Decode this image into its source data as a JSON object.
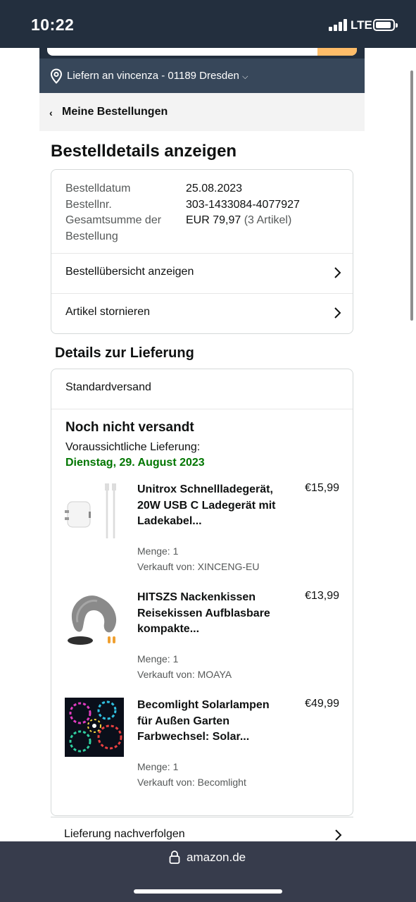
{
  "status_bar": {
    "time": "10:22",
    "network": "LTE"
  },
  "deliver_to": {
    "icon": "location-pin-icon",
    "text": "Liefern an vincenza - 01189 Dresden",
    "caret": "⌵"
  },
  "breadcrumb": {
    "label": "Meine Bestellungen"
  },
  "page_title": "Bestelldetails anzeigen",
  "order": {
    "date_label": "Bestelldatum",
    "date_value": "25.08.2023",
    "number_label": "Bestellnr.",
    "number_value": "303-1433084-4077927",
    "total_label": "Gesamtsumme der Bestellung",
    "total_value": "EUR 79,97",
    "total_count": "(3 Artikel)",
    "links": [
      {
        "label": "Bestellübersicht anzeigen"
      },
      {
        "label": "Artikel stornieren"
      }
    ]
  },
  "delivery": {
    "section_title": "Details zur Lieferung",
    "method": "Standardversand",
    "status": "Noch nicht versandt",
    "eta_label": "Voraussichtliche Lieferung:",
    "eta_date": "Dienstag, 29. August 2023",
    "status_color": "#007600",
    "items": [
      {
        "title": "Unitrox Schnellladegerät, 20W USB C Ladegerät mit Ladekabel...",
        "price": "€15,99",
        "qty": "Menge: 1",
        "seller": "Verkauft von: XINCENG-EU",
        "image": "usb-charger-image"
      },
      {
        "title": "HITSZS Nackenkissen Reisekissen Aufblasbare kompakte...",
        "price": "€13,99",
        "qty": "Menge: 1",
        "seller": "Verkauft von: MOAYA",
        "image": "neck-pillow-image"
      },
      {
        "title": "Becomlight Solarlampen für Außen Garten Farbwechsel: Solar...",
        "price": "€49,99",
        "qty": "Menge: 1",
        "seller": "Verkauft von: Becomlight",
        "image": "solar-lights-image"
      }
    ],
    "track_label": "Lieferung nachverfolgen"
  },
  "browser": {
    "url": "amazon.de",
    "icon": "lock-icon"
  },
  "colors": {
    "header": "#232f3e",
    "subheader": "#37475a",
    "accent": "#febd69",
    "browser_bar": "#373c4c"
  }
}
